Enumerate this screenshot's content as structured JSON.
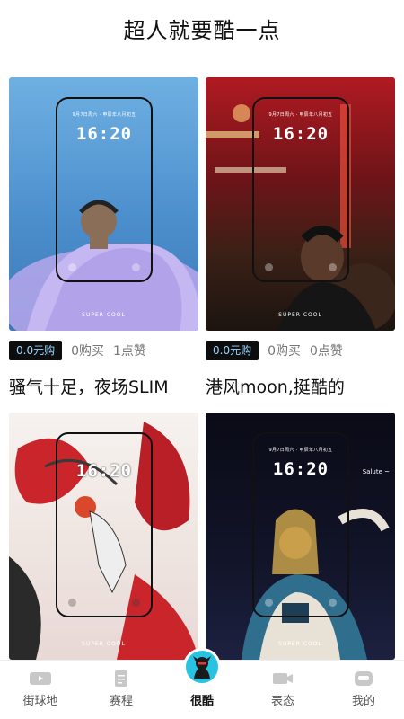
{
  "header": {
    "title": "超人就要酷一点"
  },
  "cards": [
    {
      "price": "0.0元购",
      "bought": "0购买",
      "likes": "1点赞",
      "title": "骚气十足，夜场SLIM",
      "lock_date": "9月7日周六 · 甲辰年八月初五",
      "lock_time": "16:20",
      "brand": "SUPER  COOL",
      "colors": {
        "bg_top": "#5aa1d8",
        "bg_bottom": "#3c7fc0"
      }
    },
    {
      "price": "0.0元购",
      "bought": "0购买",
      "likes": "0点赞",
      "title": "港风moon,挺酷的",
      "lock_date": "9月7日周六 · 甲辰年八月初五",
      "lock_time": "16:20",
      "brand": "SUPER  COOL",
      "colors": {
        "bg_top": "#a0141e",
        "bg_bottom": "#2a1a12"
      }
    },
    {
      "lock_time": "16:20",
      "brand": "SUPER  COOL",
      "colors": {
        "bg_top": "#f4f1ee",
        "bg_bottom": "#c4252b"
      }
    },
    {
      "lock_date": "9月7日周六 · 甲辰年八月初五",
      "lock_time": "16:20",
      "overlay_text": "Salute ~",
      "brand": "SUPER  COOL",
      "colors": {
        "bg_top": "#0c0d1c",
        "bg_bottom": "#1a1f3a"
      }
    }
  ],
  "tabbar": {
    "items": [
      {
        "label": "街球地",
        "icon": "film-icon"
      },
      {
        "label": "赛程",
        "icon": "document-icon"
      },
      {
        "label": "很酷",
        "icon": "avatar-icon",
        "active": true
      },
      {
        "label": "表态",
        "icon": "camera-icon"
      },
      {
        "label": "我的",
        "icon": "profile-icon"
      }
    ],
    "colors": {
      "accent": "#27c3e0",
      "inactive": "#c8c8c8"
    }
  }
}
